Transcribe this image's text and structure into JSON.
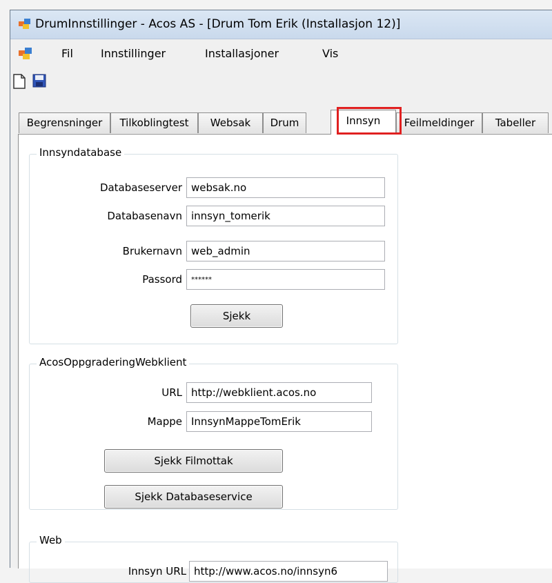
{
  "window": {
    "title": "DrumInnstillinger - Acos AS - [Drum Tom Erik (Installasjon 12)]"
  },
  "menu": {
    "items": [
      "Fil",
      "Innstillinger",
      "Installasjoner",
      "Vis"
    ]
  },
  "toolbar": {
    "buttons": [
      "new-document-icon",
      "save-icon"
    ]
  },
  "tabs": [
    "Begrensninger",
    "Tilkoblingtest",
    "Websak",
    "Drum",
    "Innsyn",
    "Feilmeldinger",
    "Tabeller"
  ],
  "active_tab": "Innsyn",
  "innsyn_db": {
    "legend": "Innsyndatabase",
    "server_label": "Databaseserver",
    "server_value": "websak.no",
    "dbname_label": "Databasenavn",
    "dbname_value": "innsyn_tomerik",
    "user_label": "Brukernavn",
    "user_value": "web_admin",
    "password_label": "Passord",
    "password_value": "******",
    "check_button": "Sjekk"
  },
  "webklient": {
    "legend": "AcosOppgraderingWebklient",
    "url_label": "URL",
    "url_value": "http://webklient.acos.no",
    "folder_label": "Mappe",
    "folder_value": "InnsynMappeTomErik",
    "check_filmottak_button": "Sjekk Filmottak",
    "check_dbservice_button": "Sjekk Databaseservice"
  },
  "web": {
    "legend": "Web",
    "innsyn_url_label": "Innsyn URL",
    "innsyn_url_value": "http://www.acos.no/innsyn6"
  }
}
